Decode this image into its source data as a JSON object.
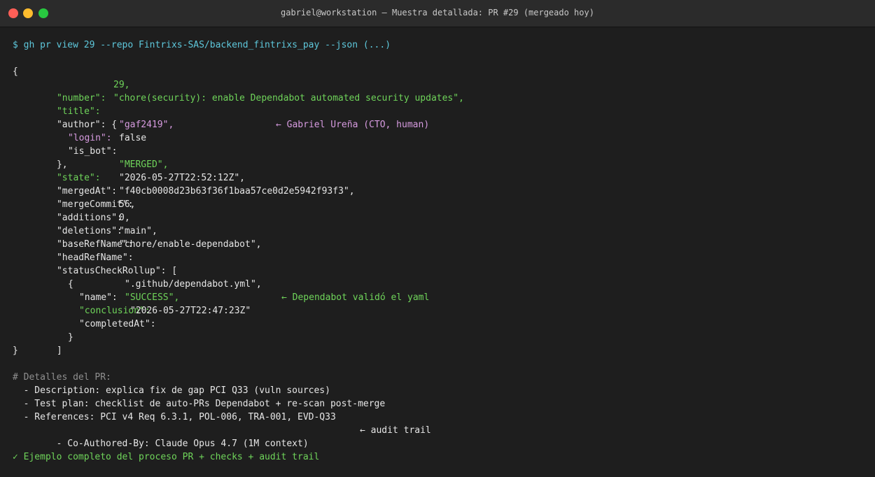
{
  "window": {
    "title": "gabriel@workstation — Muestra detallada: PR #29 (mergeado hoy)",
    "colors": {
      "background": "#1e1e1e",
      "key_green": "#6fd45a",
      "prompt_cyan": "#5ec8dc",
      "highlight_purple": "#d79be0"
    }
  },
  "terminal": {
    "command": "$ gh pr view 29 --repo Fintrixs-SAS/backend_fintrixs_pay --json (...)",
    "json": {
      "open": "{",
      "number_key": "\"number\":",
      "number_val": "29,",
      "title_key": "\"title\":",
      "title_val": "\"chore(security): enable Dependabot automated security updates\",",
      "author_open": "\"author\": {",
      "login_key": "\"login\":",
      "login_val": "\"gaf2419\",",
      "login_note": "← Gabriel Ureña (CTO, human)",
      "is_bot_key": "\"is_bot\":",
      "is_bot_val": "false",
      "author_close": "},",
      "state_key": "\"state\":",
      "state_val": "\"MERGED\",",
      "mergedAt_key": "\"mergedAt\":",
      "mergedAt_val": "\"2026-05-27T22:52:12Z\",",
      "mergeCommit_key": "\"mergeCommit\":",
      "mergeCommit_val": "\"f40cb0008d23b63f36f1baa57ce0d2e5942f93f3\",",
      "additions_key": "\"additions\":",
      "additions_val": "56,",
      "deletions_key": "\"deletions\":",
      "deletions_val": "0,",
      "baseRefName_key": "\"baseRefName\":",
      "baseRefName_val": "\"main\",",
      "headRefName_key": "\"headRefName\":",
      "headRefName_val": "\"chore/enable-dependabot\",",
      "statusCheckRollup_open": "\"statusCheckRollup\": [",
      "check_open": "{",
      "name_key": "\"name\":",
      "name_val": "\".github/dependabot.yml\",",
      "conclusion_key": "\"conclusion\":",
      "conclusion_val": "\"SUCCESS\",",
      "conclusion_note": "← Dependabot validó el yaml",
      "completedAt_key": "\"completedAt\":",
      "completedAt_val": "\"2026-05-27T22:47:23Z\"",
      "check_close": "}",
      "array_close": "]",
      "close": "}"
    },
    "details": {
      "heading": "# Detalles del PR:",
      "description": "  - Description: explica fix de gap PCI Q33 (vuln sources)",
      "test_plan": "  - Test plan: checklist de auto-PRs Dependabot + re-scan post-merge",
      "references": "  - References: PCI v4 Req 6.3.1, POL-006, TRA-001, EVD-Q33",
      "co_authored": "  - Co-Authored-By: Claude Opus 4.7 (1M context)",
      "co_authored_note": "← audit trail"
    },
    "footer": "✓ Ejemplo completo del proceso PR + checks + audit trail"
  }
}
